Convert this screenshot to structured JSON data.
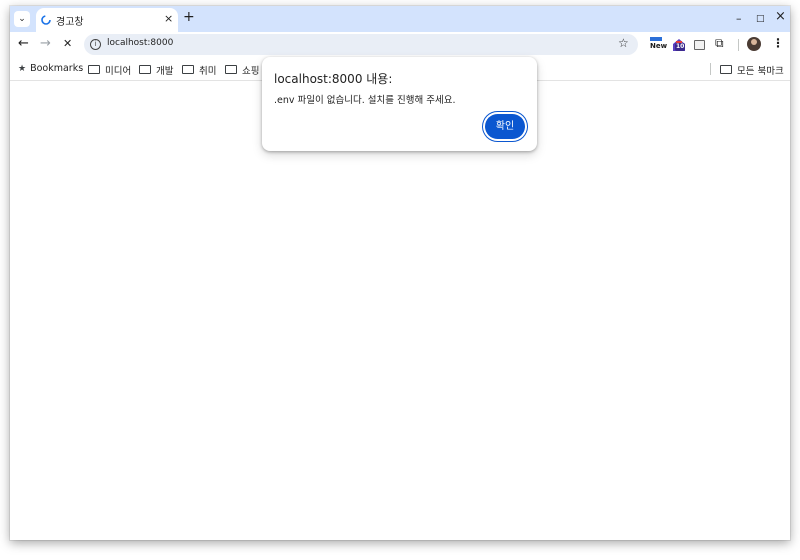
{
  "tab": {
    "title": "경고창",
    "close_glyph": "×"
  },
  "tabstrip": {
    "search_glyph": "⌄",
    "new_tab_glyph": "+"
  },
  "window_controls": {
    "minimize": "–",
    "maximize": "□",
    "close": "×"
  },
  "toolbar": {
    "back": "←",
    "forward": "→",
    "stop": "✕",
    "url": "localhost:8000",
    "star": "☆",
    "ext_new_label": "New",
    "ext_badge": "10",
    "puzzle": "⧉",
    "menu": "⋮"
  },
  "bookmarks": {
    "star": "★",
    "items": [
      "Bookmarks",
      "미디어",
      "개발",
      "취미",
      "쇼핑"
    ],
    "all_bookmarks": "모든 북마크"
  },
  "dialog": {
    "title": "localhost:8000 내용:",
    "message": ".env 파일이 없습니다. 설치를 진행해 주세요.",
    "ok_label": "확인"
  },
  "colors": {
    "tabstrip_bg": "#d3e3fd",
    "omnibox_bg": "#e9eef6",
    "accent": "#0b57d0"
  },
  "icons": [
    "tab-search-icon",
    "favicon-icon",
    "back-arrow-icon",
    "forward-arrow-icon",
    "stop-icon",
    "info-icon",
    "bookmark-star-icon",
    "extension-new-icon",
    "extension-house-icon",
    "extension-image-icon",
    "puzzle-icon",
    "profile-avatar",
    "kebab-menu-icon",
    "folder-icon",
    "bookmarks-star-icon"
  ]
}
